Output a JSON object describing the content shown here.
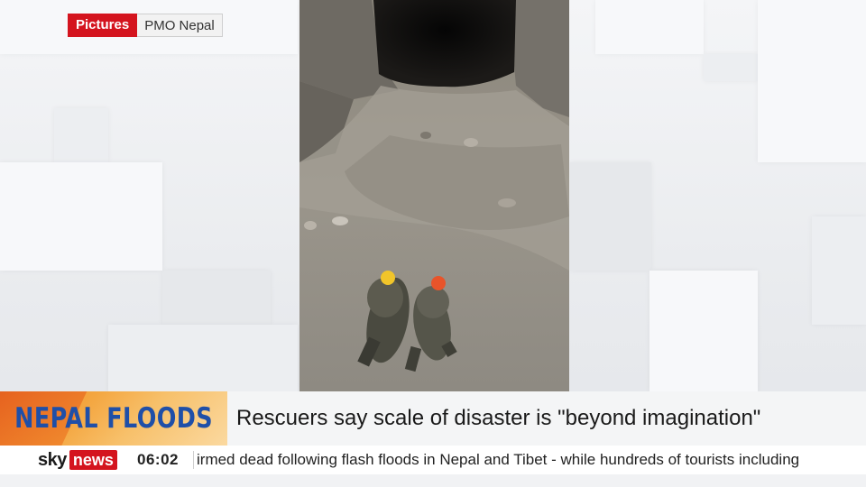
{
  "credit": {
    "tag": "Pictures",
    "source": "PMO Nepal"
  },
  "lower_third": {
    "tag": "NEPAL FLOODS",
    "headline": "Rescuers say scale of disaster is \"beyond imagination\""
  },
  "ticker": {
    "logo_sky": "sky",
    "logo_news": "news",
    "time": "06:02",
    "text": "irmed dead following flash floods in Nepal and Tibet - while hundreds of tourists including"
  },
  "colors": {
    "brand_red": "#d4141e",
    "tag_blue": "#1f4fa8",
    "tag_orange": "#f4a640"
  }
}
